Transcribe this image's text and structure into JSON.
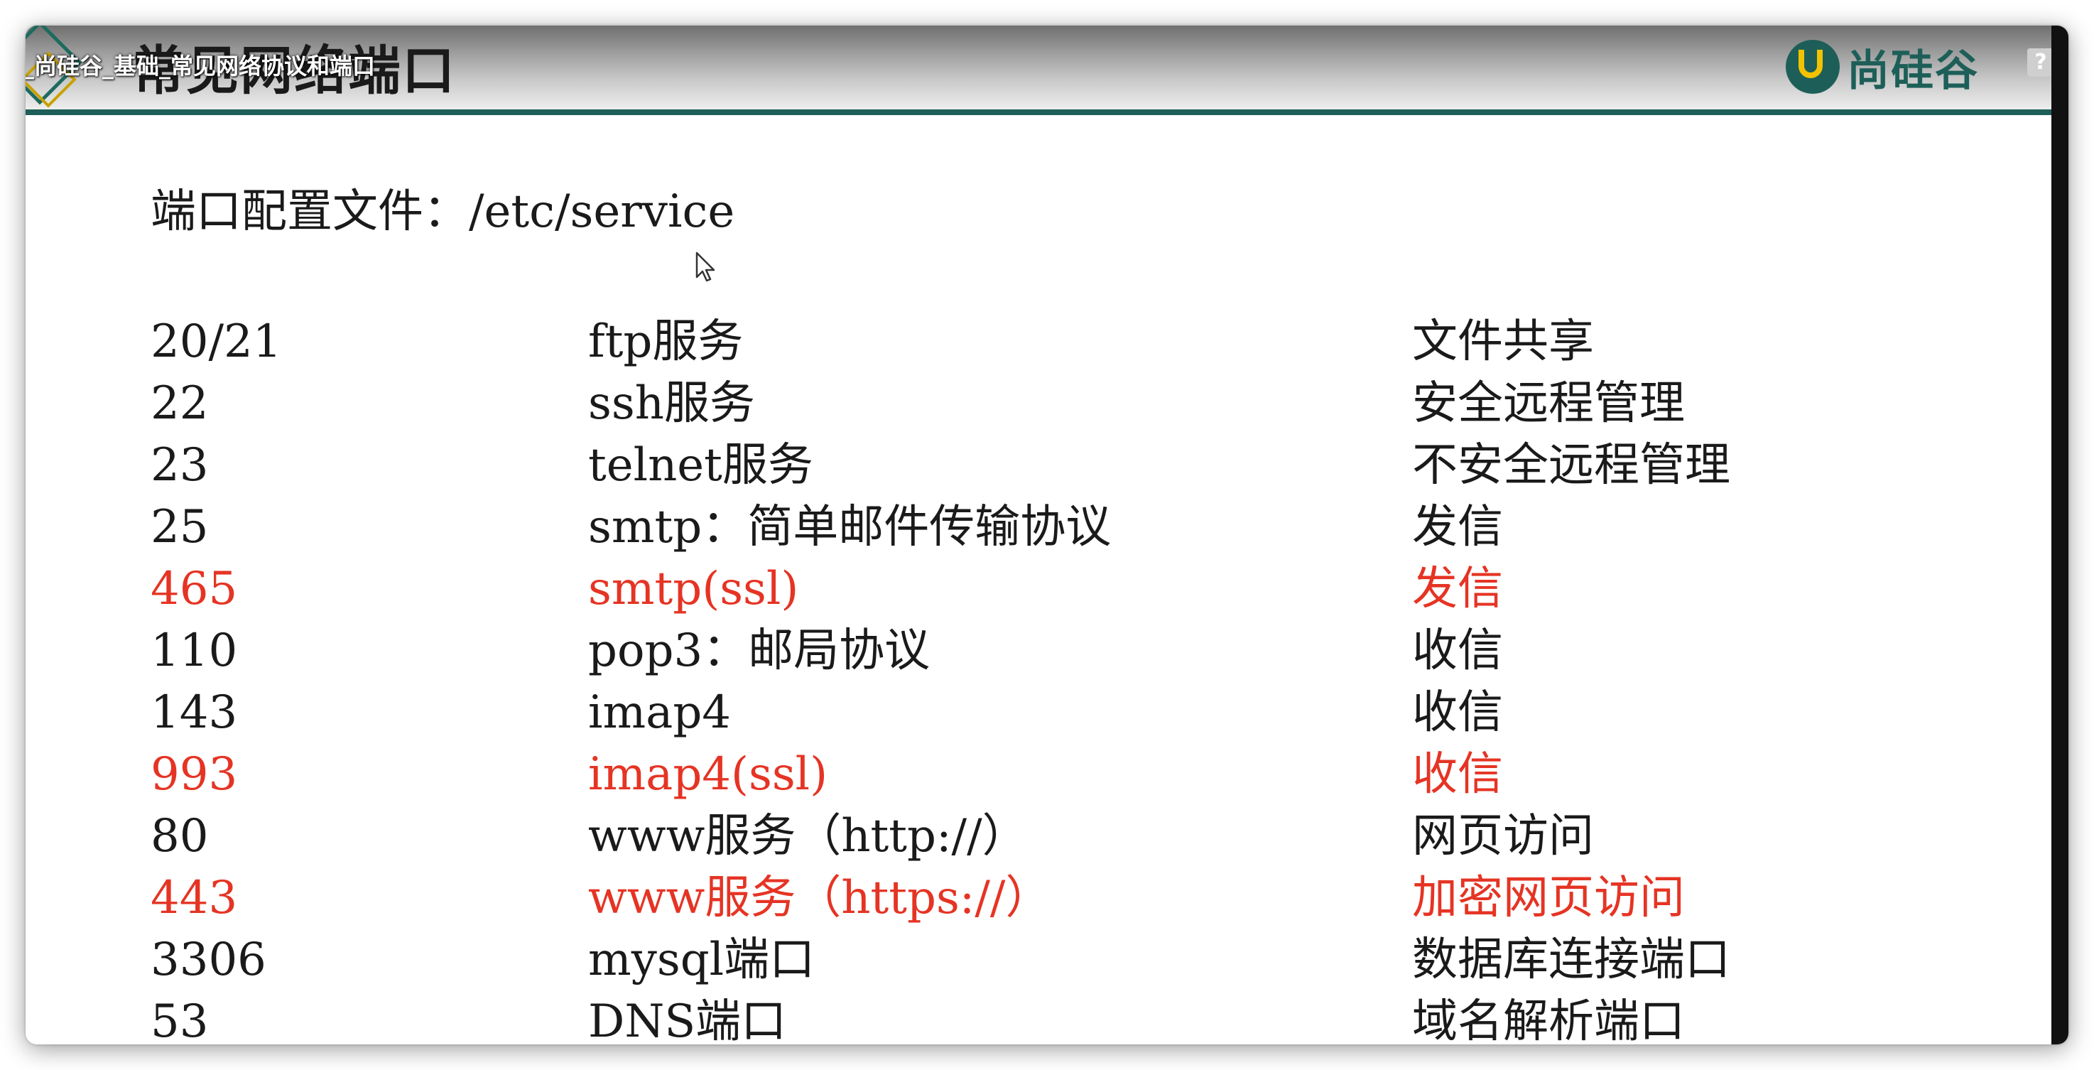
{
  "video": {
    "title": "_尚硅谷_基础_常见网络协议和端口",
    "help_icon": "question-icon"
  },
  "slide": {
    "heading": "常见网络端口",
    "brand_name": "尚硅谷",
    "config_line": "端口配置文件：/etc/service",
    "accent_color": "#1d5f58",
    "highlight_color": "#e53424",
    "rows": [
      {
        "port": "20/21",
        "service": "ftp服务",
        "use": "文件共享",
        "highlight": false
      },
      {
        "port": "22",
        "service": "ssh服务",
        "use": "安全远程管理",
        "highlight": false
      },
      {
        "port": "23",
        "service": "telnet服务",
        "use": "不安全远程管理",
        "highlight": false
      },
      {
        "port": "25",
        "service": "smtp：简单邮件传输协议",
        "use": "发信",
        "highlight": false
      },
      {
        "port": "465",
        "service": "smtp(ssl)",
        "use": "发信",
        "highlight": true
      },
      {
        "port": "110",
        "service": "pop3：邮局协议",
        "use": "收信",
        "highlight": false
      },
      {
        "port": "143",
        "service": "imap4",
        "use": "收信",
        "highlight": false
      },
      {
        "port": "993",
        "service": "imap4(ssl)",
        "use": "收信",
        "highlight": true
      },
      {
        "port": "80",
        "service": "www服务（http://）",
        "use": "网页访问",
        "highlight": false
      },
      {
        "port": "443",
        "service": "www服务（https://）",
        "use": "加密网页访问",
        "highlight": true
      },
      {
        "port": "3306",
        "service": "mysql端口",
        "use": "数据库连接端口",
        "highlight": false
      },
      {
        "port": "53",
        "service": "DNS端口",
        "use": "域名解析端口",
        "highlight": false
      }
    ]
  }
}
